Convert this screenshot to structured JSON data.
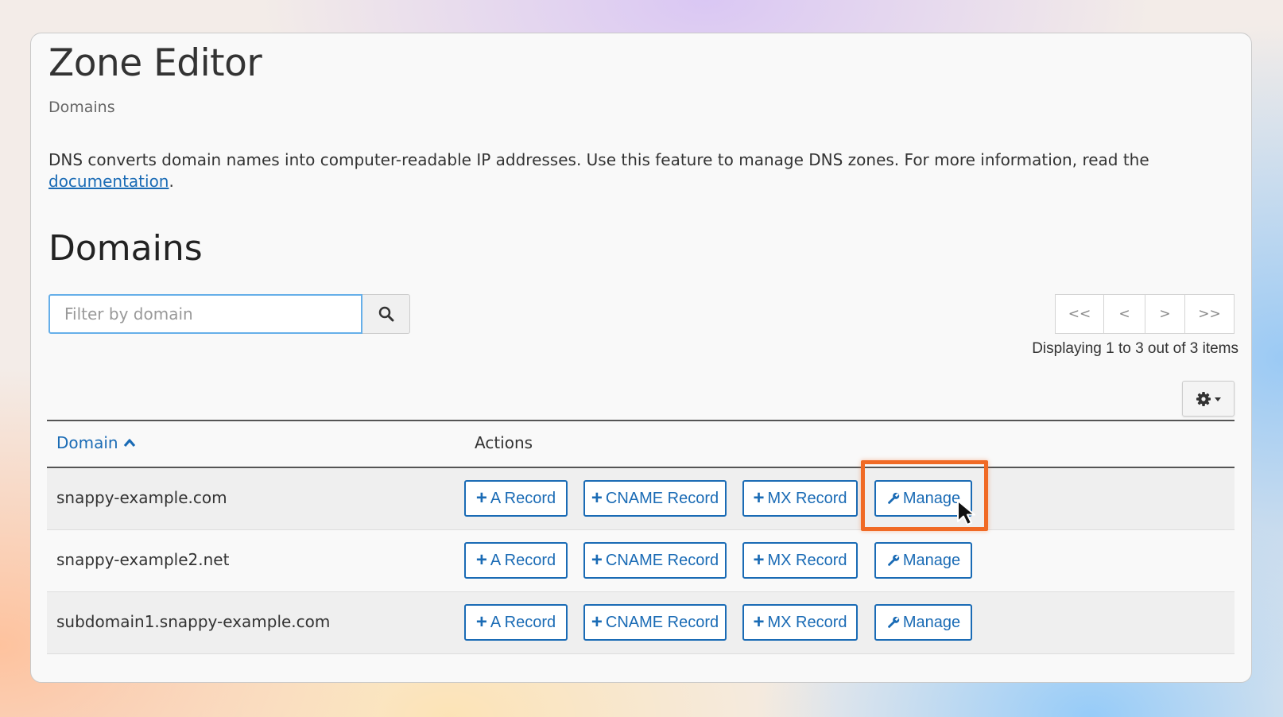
{
  "page": {
    "title": "Zone Editor",
    "breadcrumb": "Domains",
    "description": "DNS converts domain names into computer-readable IP addresses. Use this feature to manage DNS zones. For more information, read the ",
    "doc_link": "documentation",
    "description_end": "."
  },
  "domains_section": {
    "title": "Domains",
    "search": {
      "placeholder": "Filter by domain",
      "value": ""
    },
    "pager": {
      "first": "<<",
      "prev": "<",
      "next": ">",
      "last": ">>",
      "info": "Displaying 1 to 3 out of 3 items"
    }
  },
  "table": {
    "headers": {
      "domain": "Domain",
      "actions": "Actions"
    },
    "sort": "ascending",
    "rows": [
      {
        "domain": "snappy-example.com"
      },
      {
        "domain": "snappy-example2.net"
      },
      {
        "domain": "subdomain1.snappy-example.com"
      }
    ],
    "actions": {
      "a_record": "A Record",
      "cname_record": "CNAME Record",
      "mx_record": "MX Record",
      "manage": "Manage"
    }
  },
  "colors": {
    "link": "#1a6bb5",
    "highlight": "#f06a25",
    "focus_border": "#66afe9"
  },
  "icons": [
    "search-icon",
    "gear-icon",
    "caret-down-icon",
    "chevron-up-icon",
    "plus-icon",
    "wrench-icon",
    "mouse-cursor-icon"
  ]
}
